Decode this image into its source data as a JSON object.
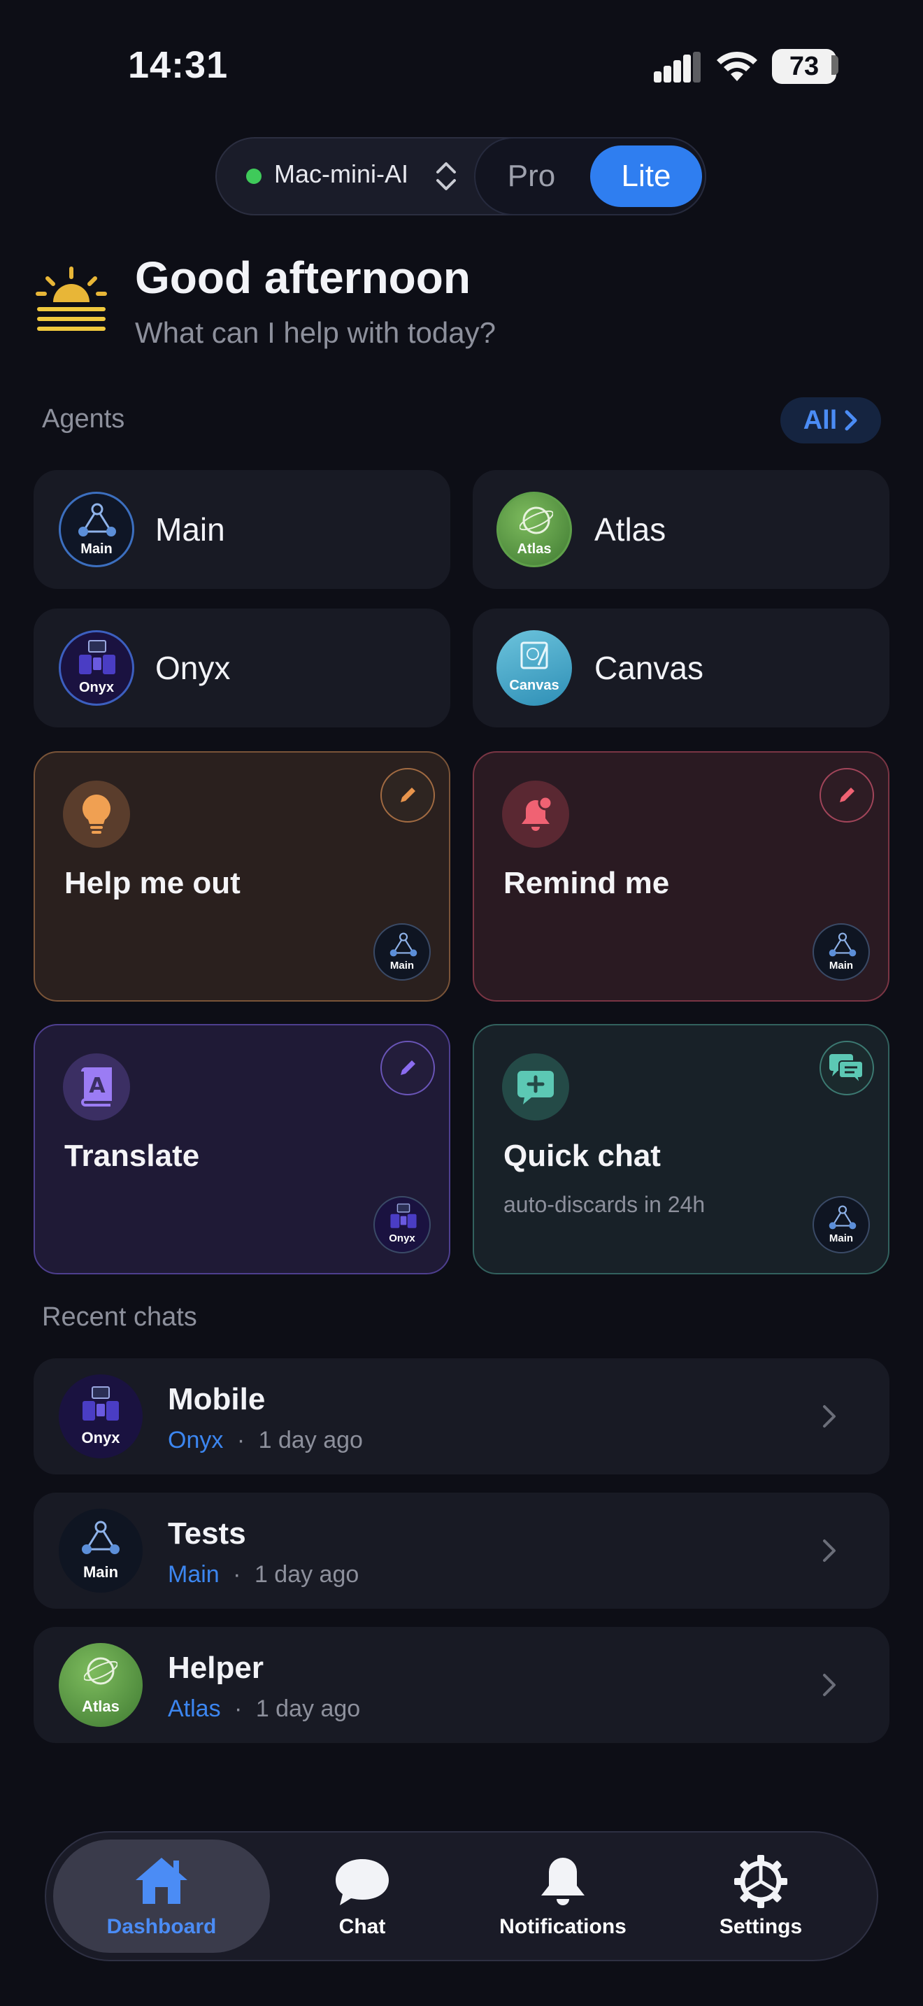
{
  "status_bar": {
    "time": "14:31",
    "battery": "73"
  },
  "mode_switch": {
    "device": "Mac-mini-AI",
    "options": [
      "Pro",
      "Lite"
    ],
    "selected": "Lite",
    "status_color": "#3fca5a"
  },
  "greeting": {
    "title": "Good afternoon",
    "subtitle": "What can I help with today?"
  },
  "agents": {
    "label": "Agents",
    "all_label": "All",
    "items": [
      {
        "name": "Main",
        "avatar_text": "Main",
        "icon": "network-icon"
      },
      {
        "name": "Atlas",
        "avatar_text": "Atlas",
        "icon": "globe-icon"
      },
      {
        "name": "Onyx",
        "avatar_text": "Onyx",
        "icon": "devices-icon"
      },
      {
        "name": "Canvas",
        "avatar_text": "Canvas",
        "icon": "canvas-icon"
      }
    ]
  },
  "actions": [
    {
      "title": "Help me out",
      "icon": "lightbulb-icon",
      "agent": "Main",
      "accent": "#e8944c"
    },
    {
      "title": "Remind me",
      "icon": "bell-icon",
      "agent": "Main",
      "accent": "#f06273"
    },
    {
      "title": "Translate",
      "icon": "translate-book-icon",
      "agent": "Onyx",
      "accent": "#8b6cf0"
    },
    {
      "title": "Quick chat",
      "subtitle": "auto-discards in 24h",
      "icon": "chat-plus-icon",
      "agent": "Main",
      "accent": "#4fc3b0"
    }
  ],
  "recent": {
    "label": "Recent chats",
    "items": [
      {
        "title": "Mobile",
        "agent": "Onyx",
        "time": "1 day ago",
        "avatar_text": "Onyx"
      },
      {
        "title": "Tests",
        "agent": "Main",
        "time": "1 day ago",
        "avatar_text": "Main"
      },
      {
        "title": "Helper",
        "agent": "Atlas",
        "time": "1 day ago",
        "avatar_text": "Atlas"
      }
    ]
  },
  "tabs": [
    {
      "label": "Dashboard",
      "icon": "home-icon",
      "active": true
    },
    {
      "label": "Chat",
      "icon": "chat-bubble-icon"
    },
    {
      "label": "Notifications",
      "icon": "bell-icon"
    },
    {
      "label": "Settings",
      "icon": "gear-icon"
    }
  ]
}
